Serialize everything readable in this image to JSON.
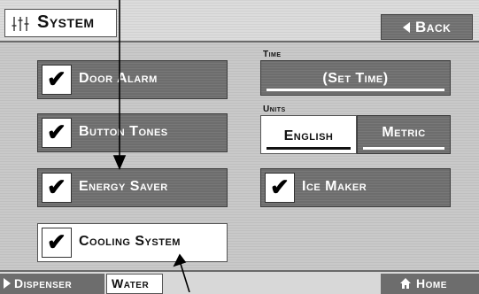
{
  "header": {
    "title": "System",
    "back_label": "Back"
  },
  "toggles": [
    {
      "label": "Door Alarm",
      "checked": true,
      "active": false
    },
    {
      "label": "Button Tones",
      "checked": true,
      "active": false
    },
    {
      "label": "Energy Saver",
      "checked": true,
      "active": false
    },
    {
      "label": "Cooling System",
      "checked": true,
      "active": true
    }
  ],
  "time": {
    "label": "Time",
    "button": "(Set Time)"
  },
  "units": {
    "label": "Units",
    "options": [
      "English",
      "Metric"
    ],
    "selected": "English"
  },
  "ice_maker": {
    "label": "Ice Maker",
    "checked": true
  },
  "footer": {
    "dispenser": "Dispenser",
    "water": "Water",
    "home": "Home"
  },
  "icons": [
    "sliders-icon",
    "back-arrow-icon",
    "checkmark-icon",
    "play-arrow-icon",
    "home-icon"
  ]
}
